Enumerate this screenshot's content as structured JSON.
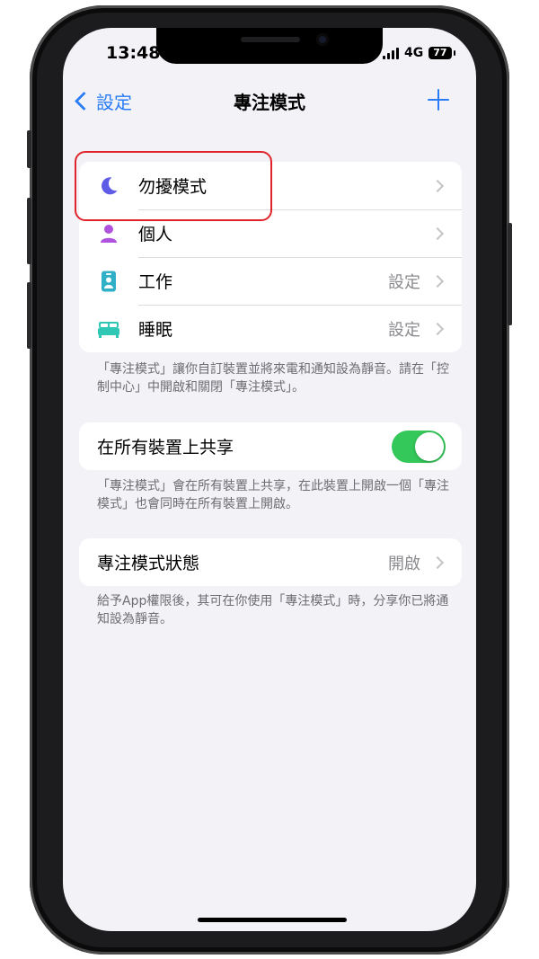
{
  "status_bar": {
    "time": "13:48",
    "network": "4G",
    "battery": "77"
  },
  "nav": {
    "back_label": "設定",
    "title": "專注模式"
  },
  "focus_modes": [
    {
      "label": "勿擾模式",
      "value": "",
      "icon": "moon-icon",
      "color": "#5e5ce6"
    },
    {
      "label": "個人",
      "value": "",
      "icon": "person-icon",
      "color": "#af52de"
    },
    {
      "label": "工作",
      "value": "設定",
      "icon": "id-badge-icon",
      "color": "#30b0c7"
    },
    {
      "label": "睡眠",
      "value": "設定",
      "icon": "bed-icon",
      "color": "#30c7b5"
    }
  ],
  "focus_footnote": "「專注模式」讓你自訂裝置並將來電和通知設為靜音。請在「控制中心」中開啟和關閉「專注模式」。",
  "share": {
    "label": "在所有裝置上共享",
    "enabled": true,
    "toggle_color": "#34c759"
  },
  "share_footnote": "「專注模式」會在所有裝置上共享，在此裝置上開啟一個「專注模式」也會同時在所有裝置上開啟。",
  "status": {
    "label": "專注模式狀態",
    "value": "開啟"
  },
  "status_footnote": "給予App權限後，其可在你使用「專注模式」時，分享你已將通知設為靜音。",
  "colors": {
    "accent": "#2a7cf6",
    "highlight": "#e0242b"
  }
}
